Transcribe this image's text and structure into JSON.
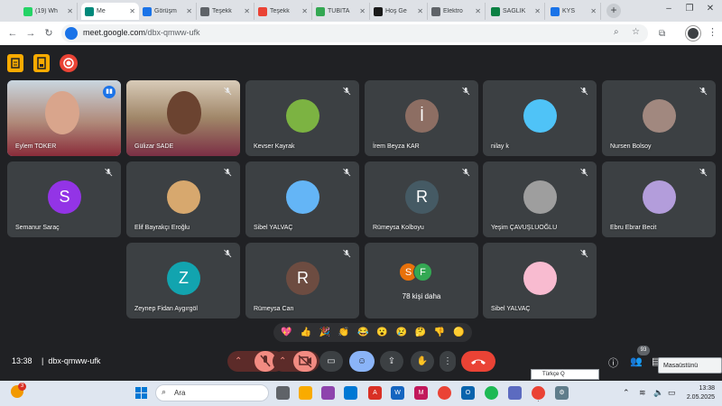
{
  "browser": {
    "tabs": [
      {
        "label": "(19) Wh",
        "favicon_color": "#25d366",
        "active": false
      },
      {
        "label": "Me",
        "favicon_color": "#00897b",
        "active": true
      },
      {
        "label": "Görüşm",
        "favicon_color": "#1a73e8",
        "active": false
      },
      {
        "label": "Teşekk",
        "favicon_color": "#5f6368",
        "active": false
      },
      {
        "label": "Teşekk",
        "favicon_color": "#ea4335",
        "active": false
      },
      {
        "label": "TÜBİTA",
        "favicon_color": "#34a853",
        "active": false
      },
      {
        "label": "Hoş Ge",
        "favicon_color": "#1a1a1a",
        "active": false
      },
      {
        "label": "Elektro",
        "favicon_color": "#5f6368",
        "active": false
      },
      {
        "label": "SAĞLIK",
        "favicon_color": "#0b8043",
        "active": false
      },
      {
        "label": "KYS",
        "favicon_color": "#1a73e8",
        "active": false
      }
    ],
    "url_host": "meet.google.com",
    "url_path": "/dbx-qmww-ufk"
  },
  "participants": [
    {
      "name": "Eylem TOKER",
      "kind": "video",
      "speaking": true
    },
    {
      "name": "Gülizar SADE",
      "kind": "video",
      "speaking": false
    },
    {
      "name": "Kevser Kayrak",
      "kind": "photo",
      "color": "#7cb342"
    },
    {
      "name": "İrem Beyza KAR",
      "kind": "letter",
      "letter": "İ",
      "color": "#8d6e63"
    },
    {
      "name": "nilay k",
      "kind": "photo",
      "color": "#4fc3f7"
    },
    {
      "name": "Nursen Bolsoy",
      "kind": "photo",
      "color": "#a1887f"
    },
    {
      "name": "Semanur Saraç",
      "kind": "letter",
      "letter": "S",
      "color": "#9334e6"
    },
    {
      "name": "Elif Bayrakçı Eroğlu",
      "kind": "photo",
      "color": "#d7a86e"
    },
    {
      "name": "Sibel YALVAÇ",
      "kind": "photo",
      "color": "#64b5f6"
    },
    {
      "name": "Rümeysa Kolboyu",
      "kind": "letter",
      "letter": "R",
      "color": "#455a64"
    },
    {
      "name": "Yeşim ÇAVUŞLUOĞLU",
      "kind": "photo",
      "color": "#9e9e9e"
    },
    {
      "name": "Ebru Ebrar Becit",
      "kind": "photo",
      "color": "#b39ddb"
    },
    {
      "name": "Zeynep Fidan Aygırgöl",
      "kind": "letter",
      "letter": "Z",
      "color": "#12a4af"
    },
    {
      "name": "Rümeysa Can",
      "kind": "letter",
      "letter": "R",
      "color": "#6d4c41"
    },
    {
      "name": "78 kişi daha",
      "kind": "more",
      "letters": [
        "S",
        "F"
      ]
    },
    {
      "name": "Sibel YALVAÇ",
      "kind": "photo",
      "color": "#f8bbd0"
    }
  ],
  "reactions": [
    "💖",
    "👍",
    "🎉",
    "👏",
    "😂",
    "😮",
    "😢",
    "🤔",
    "👎",
    "🟡"
  ],
  "meeting": {
    "time": "13:38",
    "separator": "|",
    "code": "dbx-qmww-ufk",
    "people_count": "93",
    "tooltip": "Masaüstünü göster",
    "language": "Türkçe Q"
  },
  "taskbar": {
    "search_placeholder": "Ara",
    "notification_count": "3",
    "clock_time": "13:38",
    "clock_date": "2.05.2025"
  }
}
